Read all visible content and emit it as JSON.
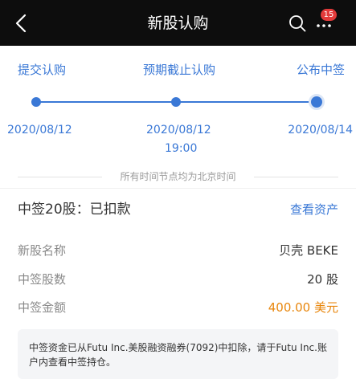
{
  "header": {
    "title": "新股认购",
    "badge_count": "15",
    "back_icon": "chevron-left-icon",
    "search_icon": "search-icon",
    "more_icon": "more-dots-icon"
  },
  "timeline": {
    "steps": [
      {
        "label": "提交认购",
        "date": "2020/08/12",
        "time": ""
      },
      {
        "label": "预期截止认购",
        "date": "2020/08/12",
        "time": "19:00"
      },
      {
        "label": "公布中签",
        "date": "2020/08/14",
        "time": ""
      }
    ],
    "note": "所有时间节点均为北京时间"
  },
  "result": {
    "title": "中签20股：已扣款",
    "view_assets_link": "查看资产"
  },
  "details": {
    "name_label": "新股名称",
    "name_value": "贝壳 BEKE",
    "shares_label": "中签股数",
    "shares_value": "20 股",
    "amount_label": "中签金额",
    "amount_value": "400.00 美元"
  },
  "notice": {
    "text": "中签资金已从Futu Inc.美股融资融券(7092)中扣除，请于Futu Inc.账户内查看中签持仓。"
  },
  "colors": {
    "accent": "#3a78d6",
    "navbar": "#0d0d0d",
    "amount": "#e8860c",
    "badge": "#e23a3a"
  }
}
